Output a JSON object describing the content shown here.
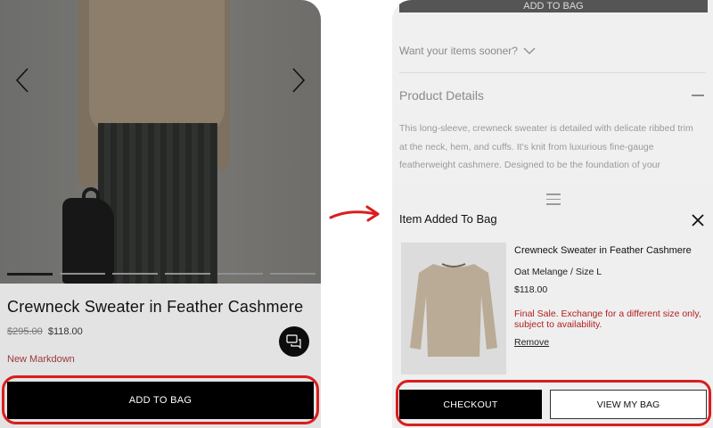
{
  "left": {
    "title": "Crewneck Sweater in Feather Cashmere",
    "price_old": "$295.00",
    "price_new": "$118.00",
    "markdown_label": "New Markdown",
    "add_to_bag": "ADD TO BAG",
    "image_count": 6,
    "active_image": 1
  },
  "right": {
    "top_add_to_bag": "ADD TO BAG",
    "sooner": "Want your items sooner?",
    "product_details_title": "Product Details",
    "product_details_body": "This long-sleeve, crewneck sweater is detailed with delicate ribbed trim at the neck, hem, and cuffs. It’s knit from luxurious fine-gauge featherweight cashmere. Designed to be the foundation of your",
    "sheet": {
      "title": "Item Added To Bag",
      "item_name": "Crewneck Sweater in Feather Cashmere",
      "item_variant": "Oat Melange / Size L",
      "item_price": "$118.00",
      "final_sale": "Final Sale. Exchange for a different size only, subject to availability.",
      "remove": "Remove",
      "checkout": "CHECKOUT",
      "view_bag": "VIEW MY BAG"
    }
  },
  "colors": {
    "highlight": "#d81e1e",
    "final_sale": "#b01f1f",
    "markdown": "#9a3a3a",
    "button_dark": "#000000",
    "sweater": "#b9ab96"
  },
  "icons": {
    "prev": "chevron-left-icon",
    "next": "chevron-right-icon",
    "chat": "chat-icon",
    "sooner": "chevron-down-icon",
    "close": "close-icon",
    "collapse": "minus-icon",
    "drag": "drag-handle-icon"
  }
}
